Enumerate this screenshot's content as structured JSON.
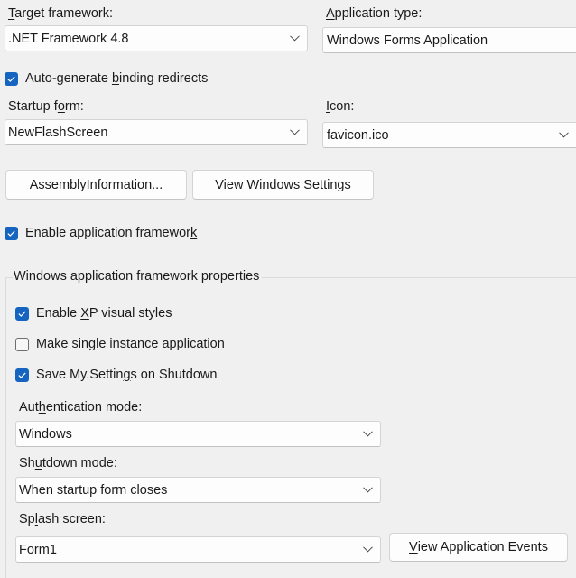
{
  "target_framework": {
    "label_pre": "",
    "label_key": "T",
    "label_post": "arget framework:",
    "value": ".NET Framework 4.8"
  },
  "application_type": {
    "label_key": "A",
    "label_post": "pplication type:",
    "value": "Windows Forms Application"
  },
  "auto_generate_binding": {
    "label_pre": "Auto-generate ",
    "label_key": "b",
    "label_post": "inding redirects",
    "checked": true
  },
  "startup_form": {
    "label_pre": "Startup f",
    "label_key": "o",
    "label_post": "rm:",
    "value": "NewFlashScreen"
  },
  "icon": {
    "label_key": "I",
    "label_post": "con:",
    "value": "favicon.ico"
  },
  "buttons": {
    "assembly_info": {
      "pre": "Assembl",
      "key": "y",
      "post": " Information..."
    },
    "view_windows_settings": {
      "pre": "View Windows Settin",
      "key": "g",
      "post": "s"
    },
    "view_application_events": {
      "pre": "",
      "key": "V",
      "post": "iew Application Events"
    }
  },
  "enable_app_framework": {
    "label_pre": "Enable application framewor",
    "label_key": "k",
    "label_post": "",
    "checked": true
  },
  "framework_group": {
    "title": "Windows application framework properties",
    "enable_xp_styles": {
      "pre": "Enable ",
      "key": "X",
      "post": "P visual styles",
      "checked": true
    },
    "single_instance": {
      "pre": "Make ",
      "key": "s",
      "post": "ingle instance application",
      "checked": false
    },
    "save_settings": {
      "pre": "Save My.Settin",
      "key": "g",
      "post": "s on Shutdown",
      "checked": true
    },
    "authentication_mode": {
      "label_pre": "Aut",
      "label_key": "h",
      "label_post": "entication mode:",
      "value": "Windows"
    },
    "shutdown_mode": {
      "label_pre": "Sh",
      "label_key": "u",
      "label_post": "tdown mode:",
      "value": "When startup form closes"
    },
    "splash_screen": {
      "label_pre": "Sp",
      "label_key": "l",
      "label_post": "ash screen:",
      "value": "Form1"
    }
  },
  "colors": {
    "accent": "#1565c0",
    "background": "#f0f0f0",
    "field_bg": "#fdfdfd"
  }
}
